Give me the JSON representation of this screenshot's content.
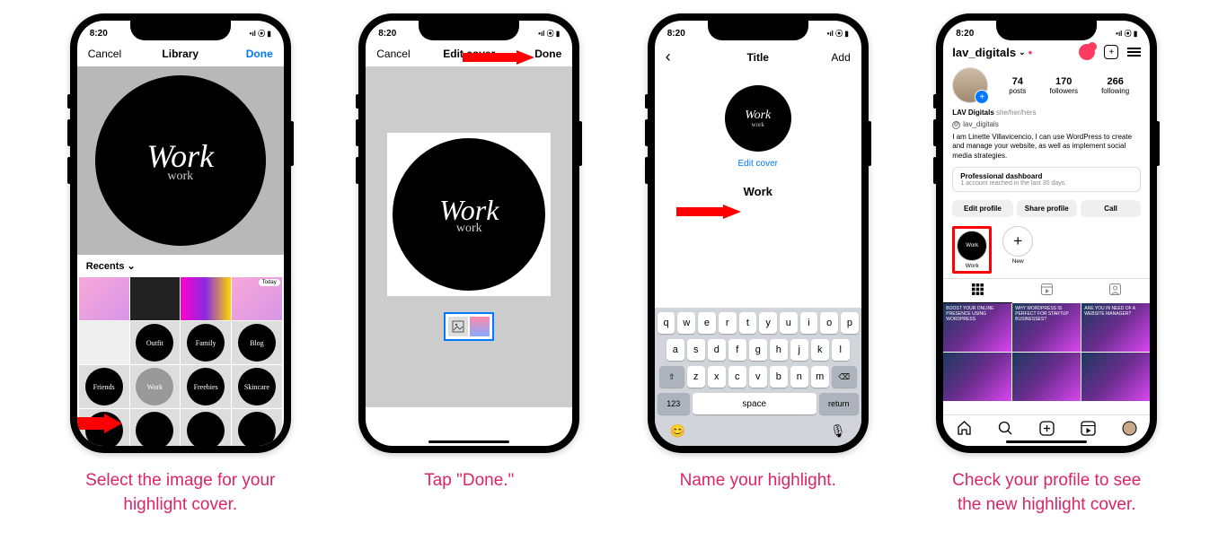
{
  "status": {
    "time": "8:20",
    "signal": "•••",
    "wifi": "⦿",
    "battery": "▢"
  },
  "screen1": {
    "nav": {
      "cancel": "Cancel",
      "title": "Library",
      "done": "Done"
    },
    "cover": {
      "line1": "Work",
      "line2": "work"
    },
    "recents": "Recents",
    "today": "Today",
    "thumbs": [
      "Outfit",
      "Family",
      "Blog",
      "Friends",
      "Work",
      "Freebies",
      "Skincare"
    ]
  },
  "screen2": {
    "nav": {
      "cancel": "Cancel",
      "title": "Edit cover",
      "done": "Done"
    },
    "cover": {
      "line1": "Work",
      "line2": "work"
    }
  },
  "screen3": {
    "nav": {
      "back": "‹",
      "title": "Title",
      "add": "Add"
    },
    "cover": {
      "line1": "Work",
      "line2": "work"
    },
    "edit_cover": "Edit cover",
    "input": "Work",
    "keyboard": {
      "row1": [
        "q",
        "w",
        "e",
        "r",
        "t",
        "y",
        "u",
        "i",
        "o",
        "p"
      ],
      "row2": [
        "a",
        "s",
        "d",
        "f",
        "g",
        "h",
        "j",
        "k",
        "l"
      ],
      "row3": [
        "z",
        "x",
        "c",
        "v",
        "b",
        "n",
        "m"
      ],
      "shift": "⇧",
      "backspace": "⌫",
      "num": "123",
      "space": "space",
      "return": "return",
      "emoji": "😊",
      "mic": "🎤"
    }
  },
  "screen4": {
    "username": "lav_digitals",
    "dot": "•",
    "stats": {
      "posts": {
        "n": "74",
        "l": "posts"
      },
      "followers": {
        "n": "170",
        "l": "followers"
      },
      "following": {
        "n": "266",
        "l": "following"
      }
    },
    "bio": {
      "name": "LAV Digitals",
      "pronouns": "she/her/hers",
      "threads": "lav_digitals",
      "text": "I am Linette Villavicencio, I can use WordPress to create and manage your website, as well as implement social media strategies."
    },
    "dashboard": {
      "t": "Professional dashboard",
      "s": "1 account reached in the last 30 days."
    },
    "buttons": {
      "edit": "Edit profile",
      "share": "Share profile",
      "call": "Call"
    },
    "highlights": {
      "work": "Work",
      "new": "New"
    },
    "posts": [
      "BOOST YOUR ONLINE PRESENCE USING WORDPRESS",
      "WHY WORDPRESS IS PERFECT FOR STARTUP BUSINESSES?",
      "ARE YOU IN NEED OF A WEBSITE MANAGER?"
    ]
  },
  "captions": {
    "c1": "Select the image for your highlight cover.",
    "c2": "Tap \"Done.\"",
    "c3": "Name your highlight.",
    "c4": "Check your profile to see the new highlight cover."
  }
}
